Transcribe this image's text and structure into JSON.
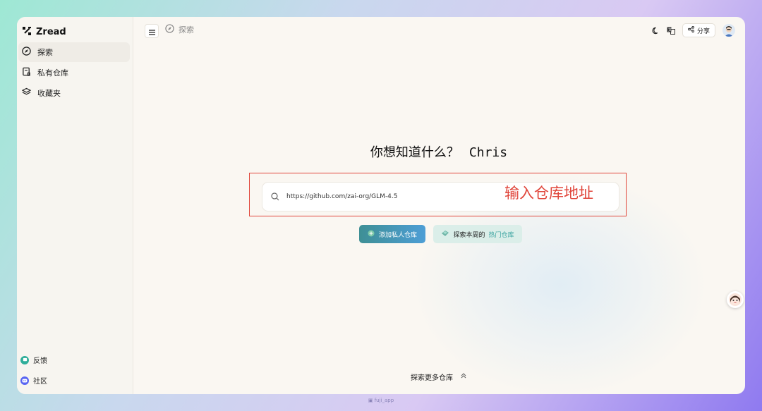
{
  "app": {
    "name": "Zread"
  },
  "sidebar": {
    "items": [
      {
        "label": "探索",
        "icon": "compass-icon",
        "active": true
      },
      {
        "label": "私有仓库",
        "icon": "repo-icon",
        "active": false
      },
      {
        "label": "收藏夹",
        "icon": "layers-icon",
        "active": false
      }
    ],
    "footer": [
      {
        "label": "反馈",
        "icon": "feedback-icon",
        "color": "#2fae9a"
      },
      {
        "label": "社区",
        "icon": "discord-icon",
        "color": "#5865f2"
      }
    ]
  },
  "topbar": {
    "breadcrumb": "探索",
    "share_label": "分享"
  },
  "main": {
    "headline": "你想知道什么？",
    "user_name": "Chris",
    "search_value": "https://github.com/zai-org/GLM-4.5",
    "annotation": "输入仓库地址",
    "primary_button": "添加私人仓库",
    "secondary_button_prefix": "探索本周的",
    "secondary_button_accent": "热门仓库",
    "explore_more": "探索更多仓库"
  },
  "watermark": "fuji_app",
  "colors": {
    "annotation": "#e0453a",
    "primary_button_start": "#3e8f95",
    "primary_button_end": "#4d9ed6",
    "accent_teal": "#3aa3a0"
  }
}
